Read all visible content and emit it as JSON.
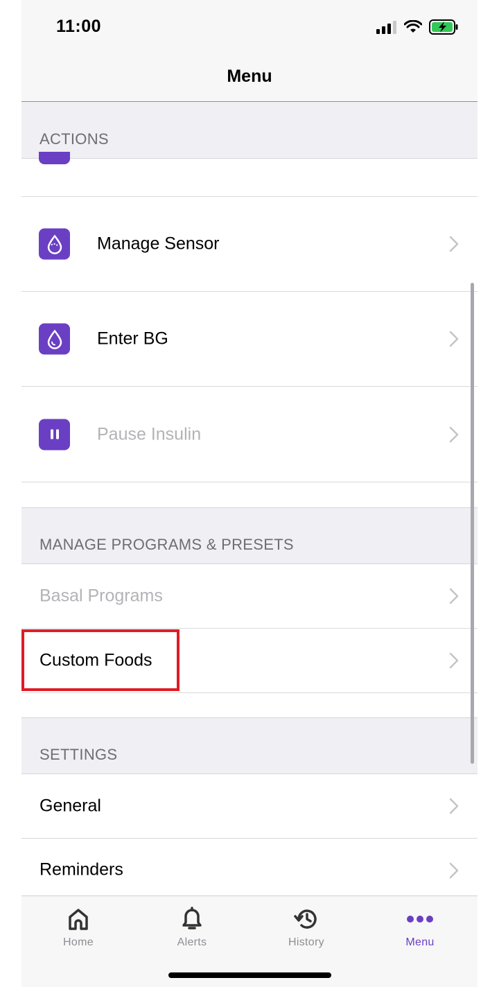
{
  "status_bar": {
    "time": "11:00"
  },
  "header": {
    "title": "Menu"
  },
  "sections": {
    "actions": "ACTIONS",
    "programs": "MANAGE PROGRAMS & PRESETS",
    "settings": "SETTINGS"
  },
  "actions": {
    "manage_sensor": "Manage Sensor",
    "enter_bg": "Enter BG",
    "pause_insulin": "Pause Insulin"
  },
  "programs": {
    "basal_programs": "Basal Programs",
    "custom_foods": "Custom Foods"
  },
  "settings": {
    "general": "General",
    "reminders": "Reminders"
  },
  "tabs": {
    "home": "Home",
    "alerts": "Alerts",
    "history": "History",
    "menu": "Menu"
  },
  "colors": {
    "accent": "#6a3fc4",
    "highlight": "#e01b24",
    "section_bg": "#efeff4"
  },
  "icons": [
    "signal-icon",
    "wifi-icon",
    "battery-charging-icon",
    "sensor-drop-icon",
    "blood-drop-icon",
    "pause-icon",
    "chevron-right-icon",
    "home-icon",
    "bell-icon",
    "history-icon",
    "more-dots-icon"
  ]
}
